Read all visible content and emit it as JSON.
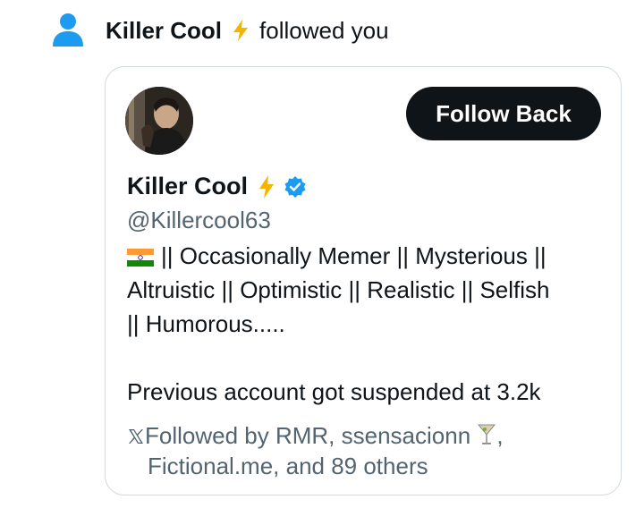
{
  "notification": {
    "actor_name": "Killer Cool",
    "text": "followed you"
  },
  "card": {
    "follow_button_label": "Follow Back",
    "display_name": "Killer Cool",
    "handle": "@Killercool63",
    "bio_line1": "|| Occasionally Memer  || Mysterious ||",
    "bio_line2": "Altruistic || Optimistic || Realistic || Selfish",
    "bio_line3": "|| Humorous.....",
    "bio_line4": "Previous account got suspended at 3.2k",
    "followed_by_1": "Followed by RMR, ssensacionn",
    "followed_by_1_end": ",",
    "followed_by_2": "Fictional.me, and 89 others"
  },
  "icons": [
    "person-icon",
    "lightning-icon",
    "verified-badge-icon",
    "india-flag-icon",
    "x-logo-icon",
    "martini-icon"
  ],
  "colors": {
    "person_icon": "#1d9bf0",
    "button_bg": "#0f1419",
    "secondary_text": "#536471",
    "card_border": "#cfd9de",
    "verified": "#1d9bf0",
    "lightning": "#f4b400"
  }
}
